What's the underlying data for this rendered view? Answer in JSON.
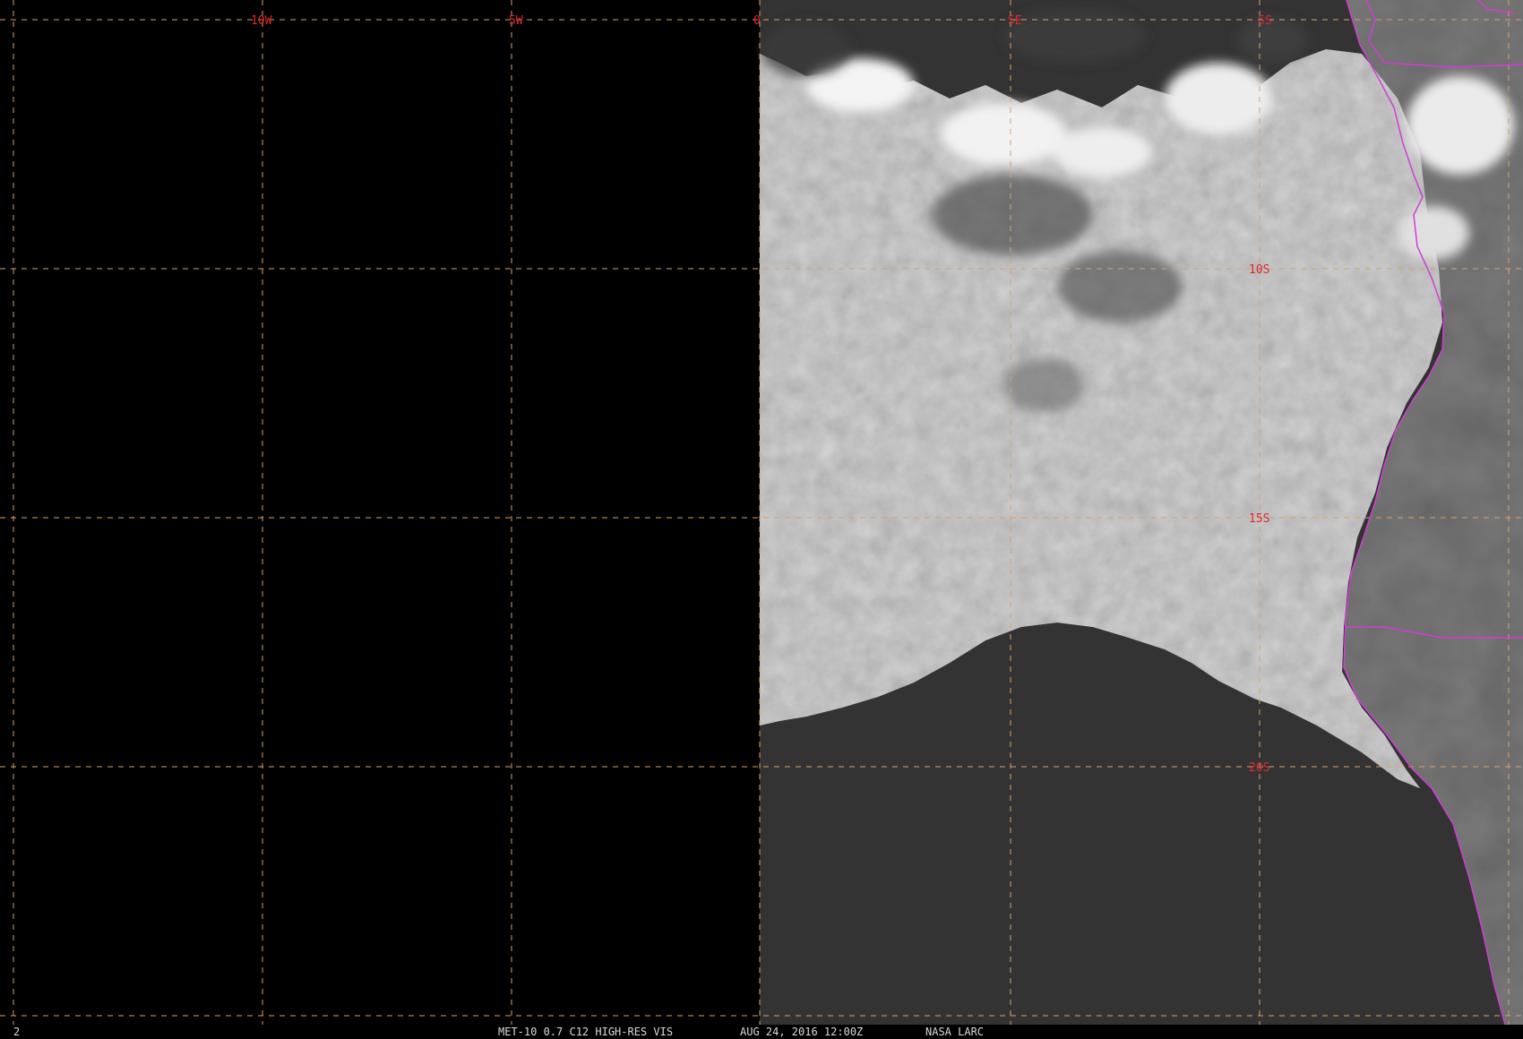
{
  "image": {
    "product": "MET-10 0.7 C12 HIGH-RES VIS",
    "datetime": "AUG 24, 2016 12:00Z",
    "source": "NASA LARC",
    "frame": "2"
  },
  "grid": {
    "longitude_labels": [
      "10W",
      "5W",
      "0",
      "5E"
    ],
    "latitude_labels": [
      "5S",
      "10S",
      "15S",
      "20S"
    ]
  },
  "colors": {
    "background": "#000000",
    "grid_line": "#d9a06a",
    "grid_label": "#e0282e",
    "boundary": "#d23cd8",
    "ocean": "#333333",
    "cloud": "#e2e2e2",
    "land": "#7a7a7a",
    "status_text": "#d8d8d8"
  }
}
